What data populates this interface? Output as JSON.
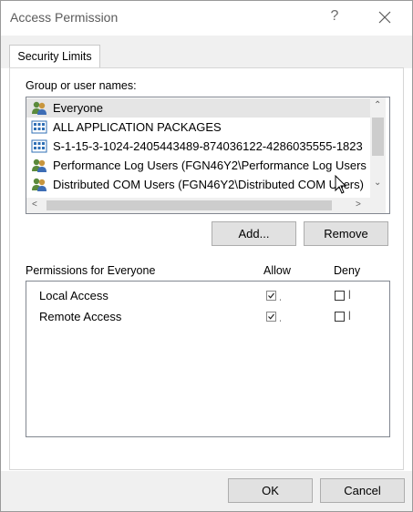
{
  "window": {
    "title": "Access Permission",
    "help": "?"
  },
  "tabs": [
    {
      "label": "Security Limits"
    }
  ],
  "group_section": {
    "label": "Group or user names:",
    "items": [
      {
        "icon": "users-group-icon",
        "text": "Everyone",
        "selected": true
      },
      {
        "icon": "app-packages-icon",
        "text": "ALL APPLICATION PACKAGES",
        "selected": false
      },
      {
        "icon": "app-packages-icon",
        "text": "S-1-15-3-1024-2405443489-874036122-4286035555-1823",
        "selected": false
      },
      {
        "icon": "users-group-icon",
        "text": "Performance Log Users (FGN46Y2\\Performance Log Users",
        "selected": false
      },
      {
        "icon": "users-group-icon",
        "text": "Distributed COM Users (FGN46Y2\\Distributed COM Users)",
        "selected": false
      }
    ]
  },
  "buttons": {
    "add": "Add...",
    "remove": "Remove",
    "ok": "OK",
    "cancel": "Cancel"
  },
  "permissions": {
    "label": "Permissions for Everyone",
    "allow_header": "Allow",
    "deny_header": "Deny",
    "rows": [
      {
        "name": "Local Access",
        "allow": true,
        "deny": false
      },
      {
        "name": "Remote Access",
        "allow": true,
        "deny": false
      }
    ]
  },
  "colors": {
    "accent": "#0078d7",
    "selection": "#e5e5e5",
    "button_face": "#e1e1e1"
  }
}
